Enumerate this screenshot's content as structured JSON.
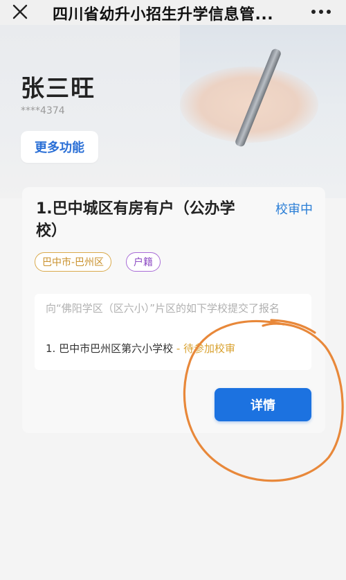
{
  "nav": {
    "title": "四川省幼升小招生升学信息管...",
    "close_icon": "close-icon",
    "more_icon": "more-dots-icon"
  },
  "user": {
    "name": "张三旺",
    "phone_masked": "****4374"
  },
  "more_functions_label": "更多功能",
  "application": {
    "title": "1.巴中城区有房有户（公办学校）",
    "status": "校审中",
    "tags": [
      "巴中市-巴州区",
      "户籍"
    ],
    "notice": "向“佛阳学区（区六小）”片区的如下学校提交了报名",
    "school": "1. 巴中市巴州区第六小学校",
    "school_status": " - 待参加校审",
    "detail_button": "详情"
  },
  "colors": {
    "accent": "#1c72e0",
    "status_blue": "#2a7ed6",
    "tag_gold": "#c9902b",
    "tag_purple": "#8f4fc4",
    "annotation_orange": "#e8883a"
  }
}
